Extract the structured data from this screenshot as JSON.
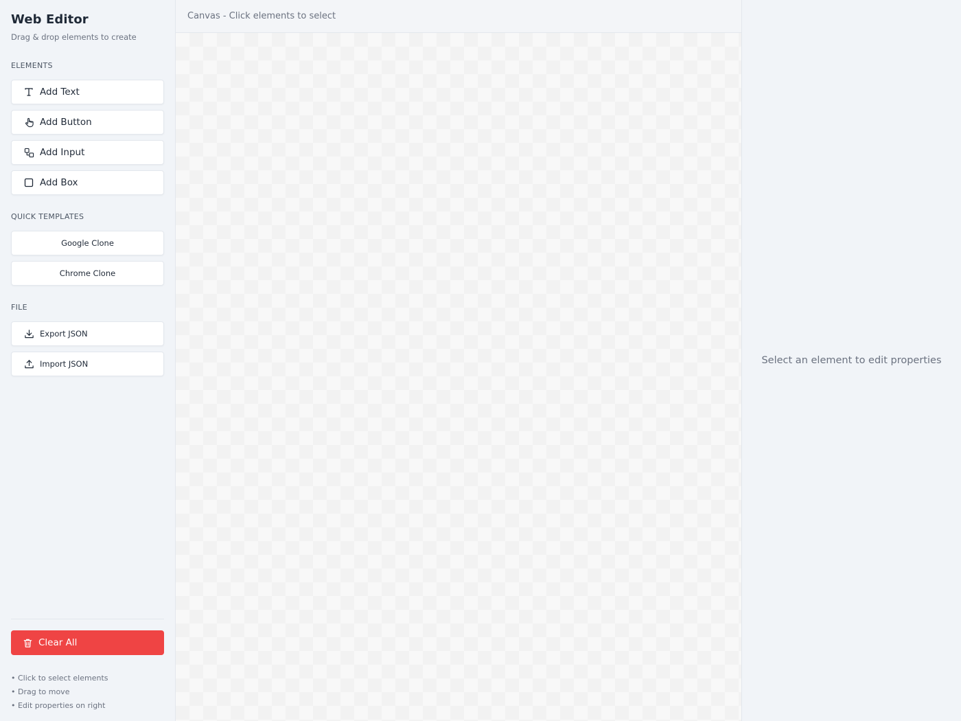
{
  "sidebar": {
    "title": "Web Editor",
    "subtitle": "Drag & drop elements to create",
    "elements_label": "ELEMENTS",
    "elements": [
      {
        "label": "Add Text",
        "icon": "text-icon"
      },
      {
        "label": "Add Button",
        "icon": "pointer-hand-icon"
      },
      {
        "label": "Add Input",
        "icon": "input-icon"
      },
      {
        "label": "Add Box",
        "icon": "square-icon"
      }
    ],
    "templates_label": "QUICK TEMPLATES",
    "templates": [
      {
        "label": "Google Clone"
      },
      {
        "label": "Chrome Clone"
      }
    ],
    "file_label": "FILE",
    "file": [
      {
        "label": "Export JSON",
        "icon": "download-icon"
      },
      {
        "label": "Import JSON",
        "icon": "upload-icon"
      }
    ],
    "clear_all": "Clear All",
    "tips": [
      "• Click to select elements",
      "• Drag to move",
      "• Edit properties on right"
    ]
  },
  "canvas": {
    "header": "Canvas - Click elements to select"
  },
  "properties": {
    "empty_message": "Select an element to edit properties"
  },
  "colors": {
    "danger": "#ef4444",
    "background": "#f1f4f8",
    "border": "#e3e7ed"
  }
}
